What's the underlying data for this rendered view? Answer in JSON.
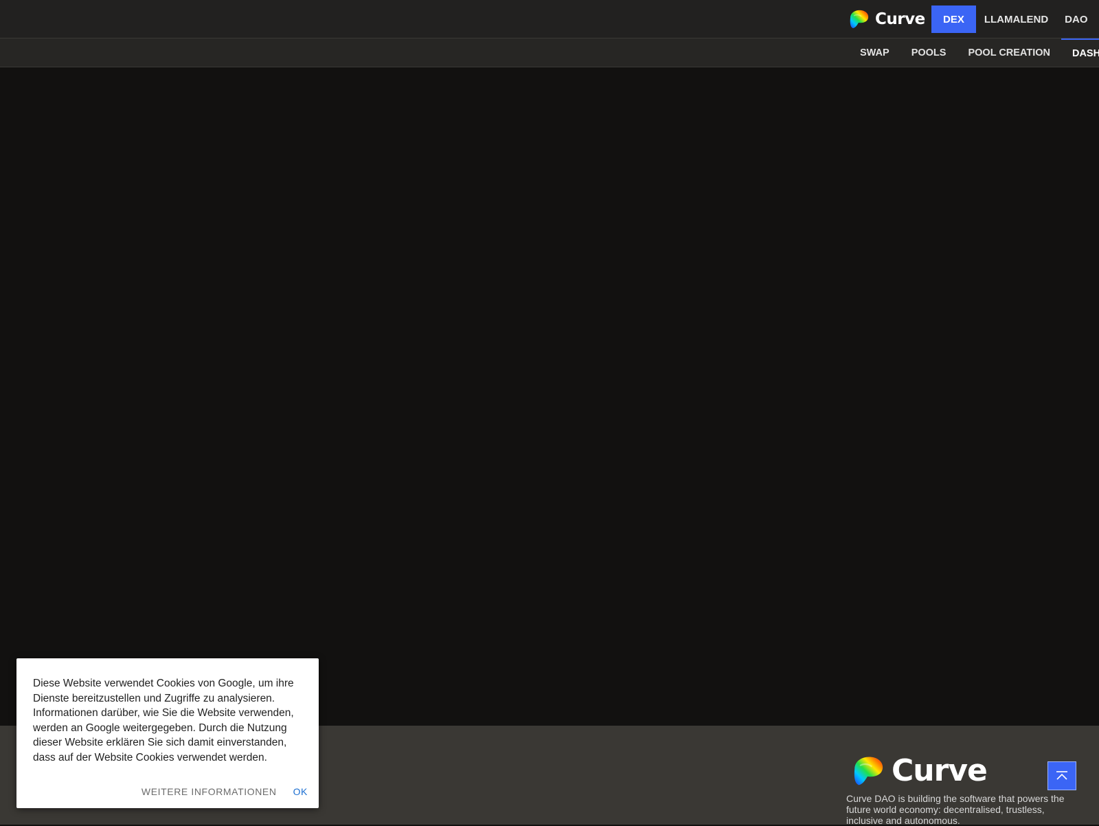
{
  "header": {
    "brand": "Curve",
    "nav": [
      "DEX",
      "LLAMALEND",
      "DAO"
    ],
    "active_nav": "DEX"
  },
  "subnav": {
    "items": [
      "SWAP",
      "POOLS",
      "POOL CREATION",
      "DASHI"
    ],
    "active_item": "DASHI"
  },
  "footer": {
    "brand": "Curve",
    "description": "Curve DAO is building the software that powers the future world economy: decentralised, trustless, inclusive and autonomous."
  },
  "cookie_banner": {
    "text": "Diese Website verwendet Cookies von Google, um ihre Dienste bereitzustellen und Zugriffe zu analysieren. Informationen darüber, wie Sie die Website verwenden, werden an Google weitergegeben. Durch die Nutzung dieser Website erklären Sie sich damit einverstanden, dass auf der Website Cookies verwendet werden.",
    "more_label": "WEITERE INFORMATIONEN",
    "ok_label": "OK"
  },
  "colors": {
    "accent": "#3b65f5",
    "topbar": "#222120",
    "page_bg": "#121110",
    "footer_bg": "#3a3834"
  },
  "icons": {
    "logo": "curve-logo-icon",
    "scroll_top": "arrow-up-to-top-icon"
  }
}
